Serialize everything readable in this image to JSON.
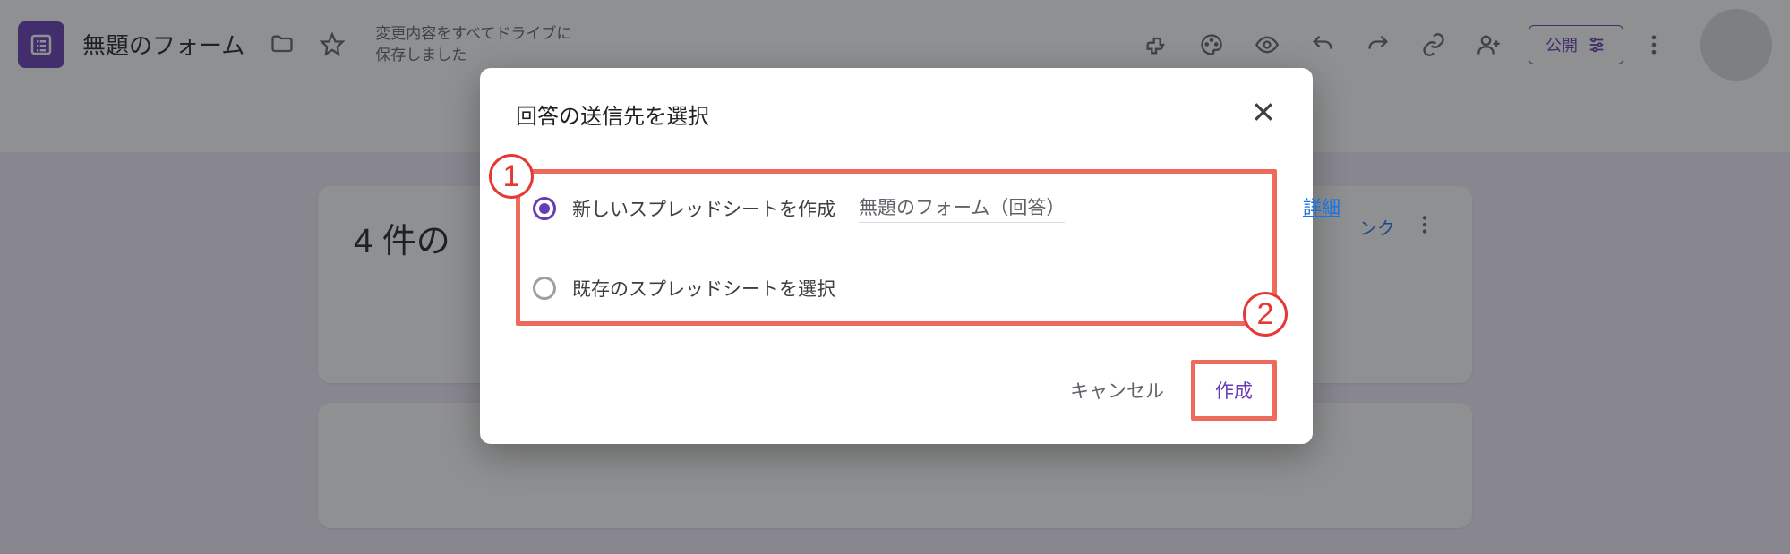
{
  "header": {
    "form_title": "無題のフォーム",
    "save_status": "変更内容をすべてドライブに保存しました",
    "publish_label": "公開"
  },
  "responses": {
    "count_label": "4 件の",
    "sheet_link_label": "ンク"
  },
  "dialog": {
    "title": "回答の送信先を選択",
    "option_new_label": "新しいスプレッドシートを作成",
    "option_new_sheetname": "無題のフォーム（回答）",
    "option_existing_label": "既存のスプレッドシートを選択",
    "details_label": "詳細",
    "cancel_label": "キャンセル",
    "create_label": "作成"
  },
  "annotations": {
    "badge1": "1",
    "badge2": "2"
  }
}
